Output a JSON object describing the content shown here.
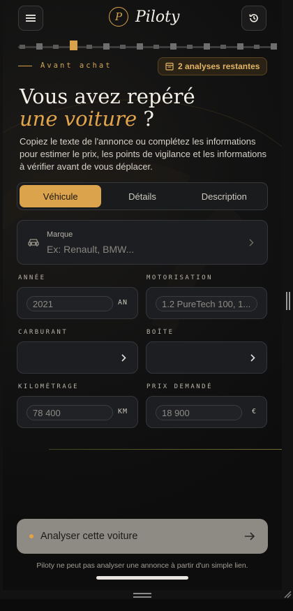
{
  "header": {
    "app_name": "Piloty",
    "logo_letter": "P",
    "menu_icon": "menu-icon",
    "history_icon": "history-icon"
  },
  "progress": {
    "total_steps": 16,
    "current_step": 3
  },
  "eyebrow": "Avant achat",
  "badge": {
    "icon": "calendar-icon",
    "label": "2 analyses restantes"
  },
  "hero": {
    "title_line1": "Vous avez repéré",
    "title_accent": "une voiture",
    "title_suffix": " ?",
    "intro": "Copiez le texte de l'annonce ou complétez les informations pour estimer le prix, les points de vigilance et les informations à vérifier avant de vous déplacer."
  },
  "tabs": [
    {
      "label": "Véhicule",
      "active": true
    },
    {
      "label": "Détails",
      "active": false
    },
    {
      "label": "Description",
      "active": false
    }
  ],
  "form": {
    "brand": {
      "label": "Marque",
      "placeholder": "Ex: Renault, BMW..."
    },
    "year": {
      "label": "ANNÉE",
      "placeholder": "2021",
      "unit": "AN"
    },
    "engine": {
      "label": "MOTORISATION",
      "placeholder": "1.2 PureTech 100, 1..."
    },
    "fuel": {
      "label": "CARBURANT",
      "value": ""
    },
    "gearbox": {
      "label": "BOÎTE",
      "value": ""
    },
    "mileage": {
      "label": "KILOMÉTRAGE",
      "placeholder": "78 400",
      "unit": "KM"
    },
    "price": {
      "label": "PRIX DEMANDÉ",
      "placeholder": "18 900",
      "unit": "€"
    }
  },
  "cta": {
    "label": "Analyser cette voiture"
  },
  "footnote": "Piloty ne peut pas analyser une annonce à partir d'un simple lien.",
  "colors": {
    "accent": "#dba34c",
    "background": "#121212",
    "card": "#1c1e21"
  }
}
